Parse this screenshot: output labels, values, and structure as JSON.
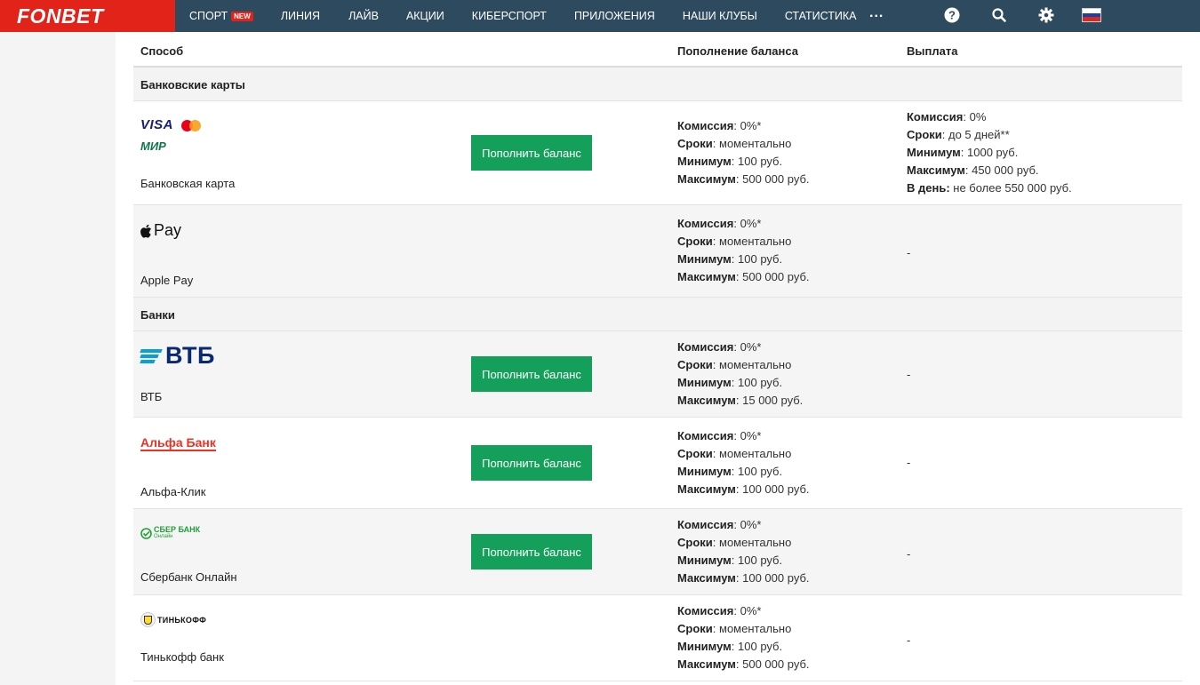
{
  "brand": {
    "name": "FONBET"
  },
  "nav": {
    "items": [
      {
        "label": "Спорт",
        "badge": "NEW"
      },
      {
        "label": "Линия"
      },
      {
        "label": "Лайв"
      },
      {
        "label": "Акции"
      },
      {
        "label": "Киберспорт"
      },
      {
        "label": "Приложения"
      },
      {
        "label": "Наши клубы"
      },
      {
        "label": "Статистика"
      }
    ],
    "more": "..."
  },
  "table": {
    "headers": {
      "method": "Способ",
      "deposit": "Пополнение баланса",
      "payout": "Выплата"
    },
    "sections": {
      "cards": "Банковские карты",
      "banks": "Банки"
    },
    "button_label": "Пополнить баланс",
    "labels": {
      "fee": "Комиссия",
      "term": "Сроки",
      "min": "Минимум",
      "max": "Максимум",
      "per_day": "В день:"
    },
    "rows": [
      {
        "name": "Банковская карта",
        "logos": [
          "VISA",
          "МИР"
        ],
        "deposit": {
          "fee": ": 0%*",
          "term": ": моментально",
          "min": ": 100 руб.",
          "max": ": 500 000 руб."
        },
        "payout": {
          "fee": ": 0%",
          "term": ": до 5 дней**",
          "min": ": 1000 руб.",
          "max": ": 450 000 руб.",
          "per_day": " не более 550 000 руб."
        }
      },
      {
        "name": "Apple Pay",
        "logos": [
          "Pay"
        ],
        "deposit": {
          "fee": ": 0%*",
          "term": ": моментально",
          "min": ": 100 руб.",
          "max": ": 500 000 руб."
        },
        "payout_text": "-"
      },
      {
        "name": "ВТБ",
        "logos": [
          "ВТБ"
        ],
        "deposit": {
          "fee": ": 0%*",
          "term": ": моментально",
          "min": ": 100 руб.",
          "max": ": 15 000 руб."
        },
        "payout_text": "-"
      },
      {
        "name": "Альфа-Клик",
        "logos": [
          "Альфа Банк"
        ],
        "deposit": {
          "fee": ": 0%*",
          "term": ": моментально",
          "min": ": 100 руб.",
          "max": ": 100 000 руб."
        },
        "payout_text": "-"
      },
      {
        "name": "Сбербанк Онлайн",
        "logos": [
          "СБЕР БАНК",
          "Онлайн"
        ],
        "deposit": {
          "fee": ": 0%*",
          "term": ": моментально",
          "min": ": 100 руб.",
          "max": ": 100 000 руб."
        },
        "payout_text": "-"
      },
      {
        "name": "Тинькофф банк",
        "logos": [
          "ТИНЬКОФФ"
        ],
        "deposit": {
          "fee": ": 0%*",
          "term": ": моментально",
          "min": ": 100 руб.",
          "max": ": 500 000 руб."
        },
        "payout_text": "-"
      }
    ]
  },
  "colors": {
    "topbar": "#2e4a5e",
    "brand_red": "#e2231a",
    "button_green": "#14a05a"
  }
}
